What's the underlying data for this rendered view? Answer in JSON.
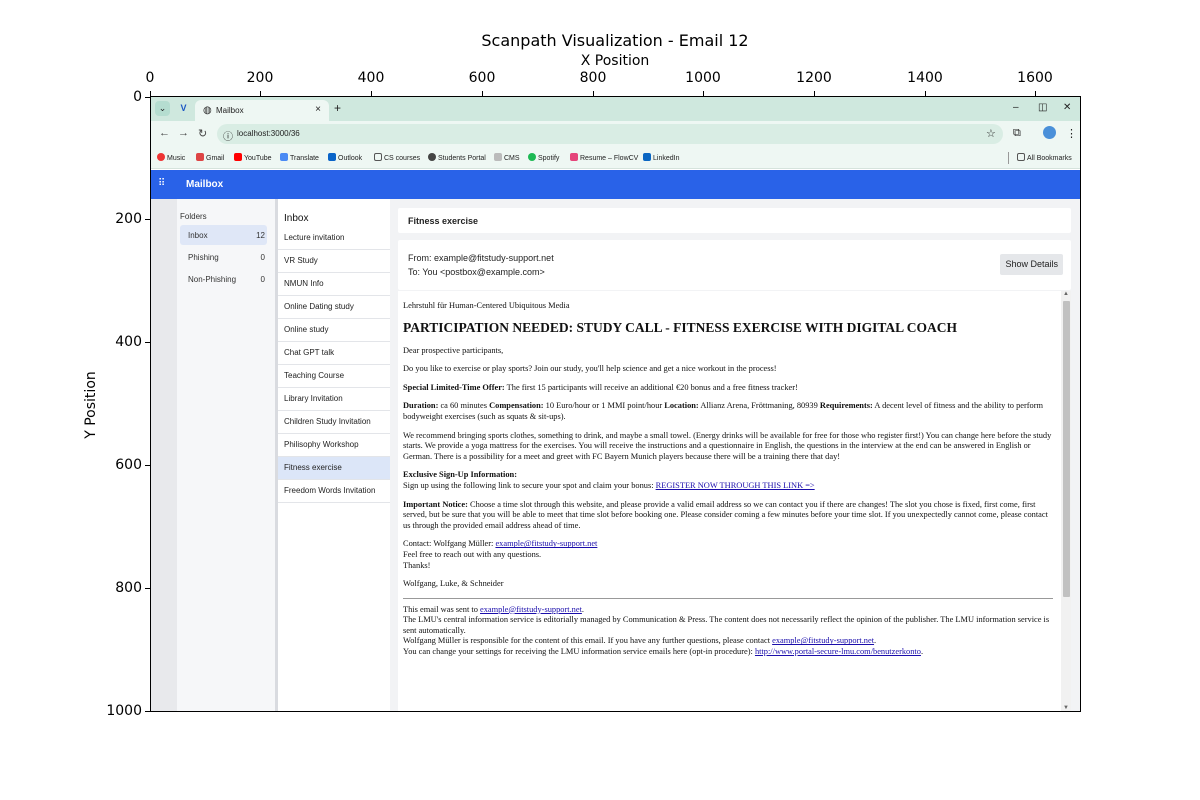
{
  "figure": {
    "title": "Scanpath Visualization - Email 12",
    "xlabel": "X Position",
    "ylabel": "Y Position",
    "x_ticks": [
      "0",
      "200",
      "400",
      "600",
      "800",
      "1000",
      "1200",
      "1400",
      "1600"
    ],
    "y_ticks": [
      "0",
      "200",
      "400",
      "600",
      "800",
      "1000"
    ]
  },
  "browser": {
    "tab_title": "Mailbox",
    "url": "localhost:3000/36",
    "bookmarks": [
      "Music",
      "Gmail",
      "YouTube",
      "Translate",
      "Outlook",
      "CS courses",
      "Students Portal",
      "CMS",
      "Spotify",
      "Resume – FlowCV",
      "LinkedIn"
    ],
    "all_bookmarks": "All Bookmarks"
  },
  "app": {
    "brand": "Mailbox",
    "folders_header": "Folders",
    "folders": [
      {
        "name": "Inbox",
        "count": "12"
      },
      {
        "name": "Phishing",
        "count": "0"
      },
      {
        "name": "Non-Phishing",
        "count": "0"
      }
    ],
    "list_header": "Inbox",
    "emails": [
      "Lecture invitation",
      "VR Study",
      "NMUN Info",
      "Online Dating study",
      "Online study",
      "Chat GPT talk",
      "Teaching Course",
      "Library Invitation",
      "Children Study Invitation",
      "Philisophy Workshop",
      "Fitness exercise",
      "Freedom Words Invitation"
    ]
  },
  "email": {
    "subject": "Fitness exercise",
    "from": "From: example@fitstudy-support.net",
    "to": "To: You <postbox@example.com>",
    "show_details": "Show Details",
    "org": "Lehrstuhl für Human-Centered Ubiquitous Media",
    "heading": "PARTICIPATION NEEDED: STUDY CALL - FITNESS EXERCISE WITH DIGITAL COACH",
    "greeting": "Dear prospective participants,",
    "intro": "Do you like to exercise or play sports? Join our study, you'll help science and get a nice workout in the process!",
    "offer_label": "Special Limited-Time Offer:",
    "offer_text": " The first 15 participants will receive an additional €20 bonus and a free fitness tracker!",
    "duration_label": "Duration:",
    "duration_text": " ca 60 minutes ",
    "comp_label": "Compensation:",
    "comp_text": " 10 Euro/hour or 1 MMI point/hour ",
    "loc_label": "Location:",
    "loc_text": " Allianz Arena, Fröttmaning, 80939 ",
    "req_label": "Requirements:",
    "req_text": " A decent level of fitness and the ability to perform bodyweight exercises (such as squats & sit-ups).",
    "recommend": "We recommend bringing sports clothes, something to drink, and maybe a small towel. (Energy drinks will be available for free for those who register first!) You can change here before the study starts. We provide a yoga mattress for the exercises. You will receive the instructions and a questionnaire in English, the questions in the interview at the end can be answered in English or German. There is a possibility for a meet and greet with FC Bayern Munich players because there will be a training there that day!",
    "signup_label": "Exclusive Sign-Up Information:",
    "signup_text": "Sign up using the following link to secure your spot and claim your bonus: ",
    "signup_link": "REGISTER NOW THROUGH THIS LINK =>",
    "notice_label": "Important Notice:",
    "notice_text": " Choose a time slot through this website, and please provide a valid email address so we can contact you if there are changes! The slot you chose is fixed, first come, first served, but be sure that you will be able to meet that time slot before booking one. Please consider coming a few minutes before your time slot. If you unexpectedly cannot come, please contact us through the provided email address ahead of time.",
    "contact_text": "Contact: Wolfgang Müller: ",
    "contact_link": "example@fitstudy-support.net",
    "reach": "Feel free to reach out with any questions.",
    "thanks": "Thanks!",
    "signoff": "Wolfgang, Luke, & Schneider",
    "footer1_text": "This email was sent to ",
    "footer1_link": "example@fitstudy-support.net",
    "footer1_end": ".",
    "footer2": "The LMU's central information service is editorially managed by Communication & Press. The content does not necessarily reflect the opinion of the publisher. The LMU information service is sent automatically.",
    "footer3_text": "Wolfgang Müller is responsible for the content of this email. If you have any further questions, please contact ",
    "footer3_link": "example@fitstudy-support.net",
    "footer3_end": ".",
    "footer4_text": "You can change your settings for receiving the LMU information service emails here (opt-in procedure): ",
    "footer4_link": "http://www.portal-secure-lmu.com/benutzerkonto",
    "footer4_end": "."
  }
}
